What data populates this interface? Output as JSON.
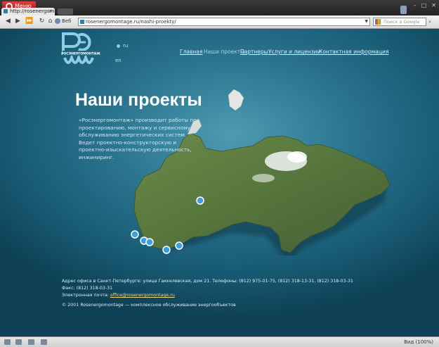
{
  "browser": {
    "menu_label": "Меню",
    "tab_title": "http://rosenergomont...",
    "web_label": "Веб",
    "url": "rosenergomontage.ru/nashi-proekty/",
    "search_placeholder": "Поиск в Google",
    "zoom": "Вид (100%)"
  },
  "site": {
    "logo_text": "РОСЭНЕРГОМОНТАЖ",
    "lang_ru": "ru",
    "lang_en": "en",
    "nav": [
      "Главная",
      "Наши проекты",
      "Партнеры",
      "Услуги и лицензии",
      "Контактная информация"
    ],
    "heading": "Наши проекты",
    "intro": "«Росэнергомонтаж» производит работы по проектированию, монтажу и сервисному обслуживанию энергетических систем. Ведет проектно-конструкторскую и проектно-изыскательскую деятельность, инжиниринг.",
    "footer": {
      "address": "Адрес офиса в Санкт-Петербурге: улица Гаккелевская, дом 21. Телефоны: (812) 975-01-75, (812) 318-13-31, (812) 318-03-31",
      "fax": "Факс: (812) 318-03-31",
      "email_label": "Электронная почта:",
      "email": "office@rosenergomontage.ru",
      "copyright": "© 2001 Rosenergomontage — комплексное обслуживание энергообъектов"
    }
  },
  "colors": {
    "accent": "#8fcde4",
    "background": "#2c7590",
    "link_footer": "#f3d27a"
  }
}
